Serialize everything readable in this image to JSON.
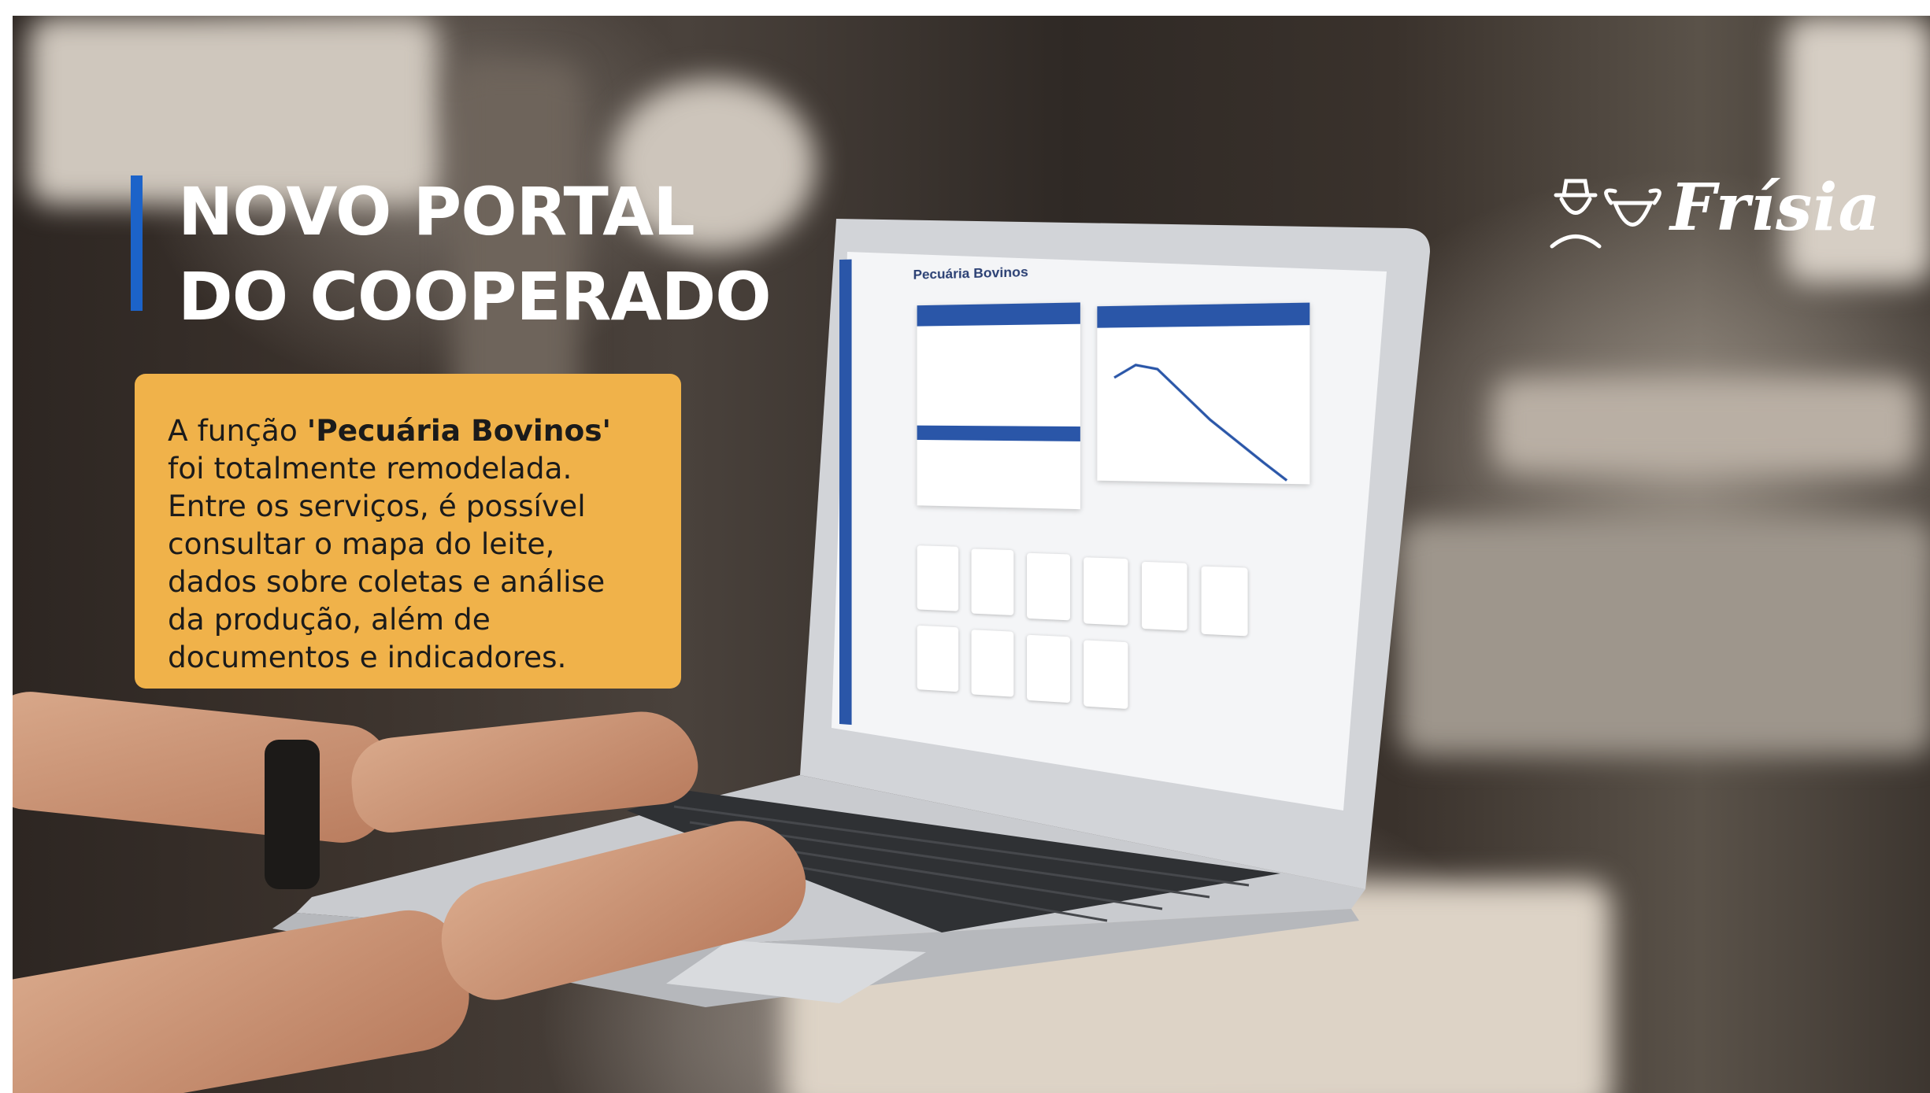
{
  "headline": {
    "line1": "NOVO PORTAL",
    "line2": "DO COOPERADO"
  },
  "info_box": {
    "prefix": "A função ",
    "highlight": "'Pecuária Bovinos'",
    "body": "foi totalmente remodelada. Entre os serviços, é possível consultar o mapa do leite, dados sobre coletas e análise da produção, além de documentos e indicadores."
  },
  "logo": {
    "text": "Frísia"
  },
  "laptop_screen": {
    "page_title": "Pecuária Bovinos",
    "tiles_row1_count": 6,
    "tiles_row2_count": 4
  },
  "colors": {
    "accent_blue": "#1c63c9",
    "info_box_bg": "#f0b24a",
    "portal_blue": "#2a56a8"
  }
}
